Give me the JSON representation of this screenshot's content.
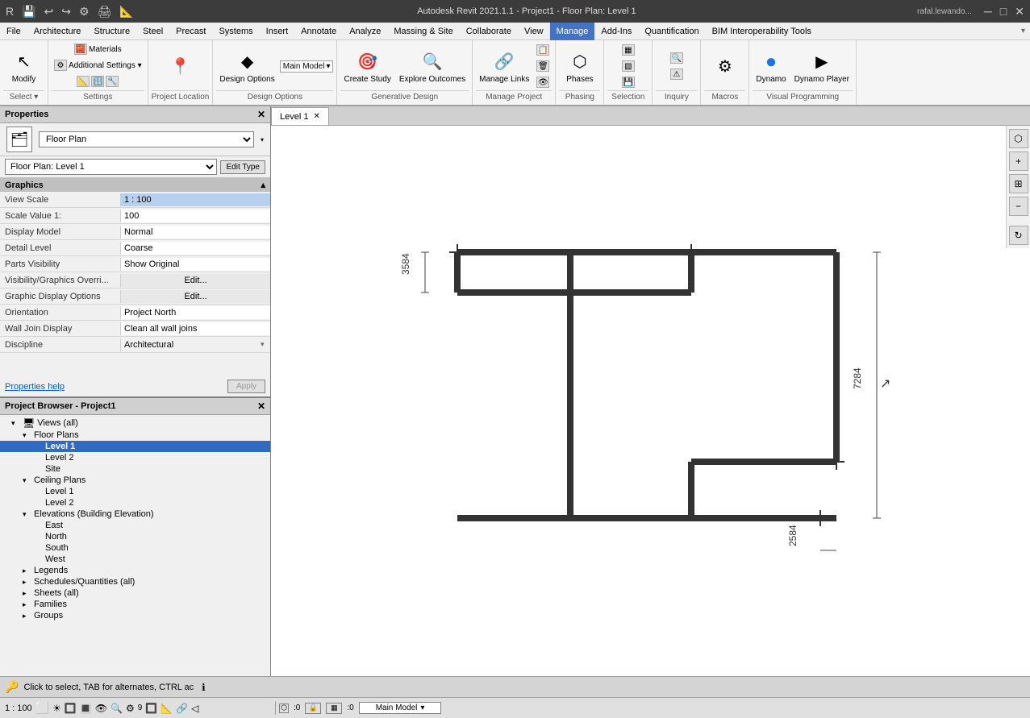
{
  "titlebar": {
    "title": "Autodesk Revit 2021.1.1 - Project1 - Floor Plan: Level 1",
    "user": "rafal.lewando...",
    "min": "─",
    "max": "□",
    "close": "✕"
  },
  "quickaccess": [
    "↩",
    "↪",
    "💾",
    "⚙",
    "▶"
  ],
  "menu": {
    "items": [
      "File",
      "Architecture",
      "Structure",
      "Steel",
      "Precast",
      "Systems",
      "Insert",
      "Annotate",
      "Analyze",
      "Massing & Site",
      "Collaborate",
      "View",
      "Manage",
      "Add-Ins",
      "Quantification",
      "BIM Interoperability Tools"
    ]
  },
  "ribbon": {
    "active_tab": "Manage",
    "groups": [
      {
        "label": "Select",
        "buttons": [
          {
            "icon": "↖",
            "label": "Modify",
            "large": true
          }
        ]
      },
      {
        "label": "Settings",
        "buttons": [
          {
            "icon": "🧱",
            "label": "Materials"
          },
          {
            "icon": "⚙",
            "label": "Additional\nSettings"
          },
          {
            "icon": "📐",
            "label": ""
          },
          {
            "icon": "🔢",
            "label": ""
          },
          {
            "icon": "🔧",
            "label": ""
          }
        ]
      },
      {
        "label": "Project Location",
        "buttons": [
          {
            "icon": "📍",
            "label": ""
          }
        ]
      },
      {
        "label": "Design Options",
        "buttons": [
          {
            "icon": "◆",
            "label": "Design Options"
          },
          {
            "icon": "▾",
            "label": "Main Model"
          }
        ]
      },
      {
        "label": "Generative Design",
        "buttons": [
          {
            "icon": "🎯",
            "label": "Create Study"
          },
          {
            "icon": "🔍",
            "label": "Explore Outcomes"
          }
        ]
      },
      {
        "label": "Manage Project",
        "buttons": [
          {
            "icon": "🔗",
            "label": "Manage Links"
          },
          {
            "icon": "📋",
            "label": ""
          },
          {
            "icon": "📊",
            "label": ""
          }
        ]
      },
      {
        "label": "Phasing",
        "buttons": [
          {
            "icon": "⬡",
            "label": "Phases"
          }
        ]
      },
      {
        "label": "Selection",
        "buttons": [
          {
            "icon": "▦",
            "label": ""
          },
          {
            "icon": "▧",
            "label": ""
          }
        ]
      },
      {
        "label": "Inquiry",
        "buttons": [
          {
            "icon": "📏",
            "label": ""
          },
          {
            "icon": "📐",
            "label": ""
          }
        ]
      },
      {
        "label": "Macros",
        "buttons": [
          {
            "icon": "⚙",
            "label": ""
          }
        ]
      },
      {
        "label": "Visual Programming",
        "buttons": [
          {
            "icon": "🔵",
            "label": "Dynamo"
          },
          {
            "icon": "▶",
            "label": "Dynamo Player"
          }
        ]
      }
    ]
  },
  "properties": {
    "title": "Properties",
    "type": "Floor Plan",
    "instance_label": "Floor Plan: Level 1",
    "edit_type_btn": "Edit Type",
    "section_label": "Graphics",
    "rows": [
      {
        "label": "View Scale",
        "value": "1 : 100",
        "blue": true
      },
      {
        "label": "Scale Value  1:",
        "value": "100",
        "blue": false
      },
      {
        "label": "Display Model",
        "value": "Normal",
        "blue": false
      },
      {
        "label": "Detail Level",
        "value": "Coarse",
        "blue": false
      },
      {
        "label": "Parts Visibility",
        "value": "Show Original",
        "blue": false
      },
      {
        "label": "Visibility/Graphics Overri...",
        "value": "Edit...",
        "blue": false,
        "editbtn": true
      },
      {
        "label": "Graphic Display Options",
        "value": "Edit...",
        "blue": false,
        "editbtn": true
      },
      {
        "label": "Orientation",
        "value": "Project North",
        "blue": false
      },
      {
        "label": "Wall Join Display",
        "value": "Clean all wall joins",
        "blue": false
      },
      {
        "label": "Discipline",
        "value": "Architectural",
        "blue": false
      }
    ],
    "props_help": "Properties help",
    "apply_btn": "Apply"
  },
  "browser": {
    "title": "Project Browser - Project1",
    "tree": [
      {
        "level": 1,
        "label": "Views (all)",
        "icon": "▾",
        "expanded": true
      },
      {
        "level": 2,
        "label": "Floor Plans",
        "icon": "▾",
        "expanded": true,
        "folderIcon": "📁"
      },
      {
        "level": 3,
        "label": "Level 1",
        "bold": true,
        "selected": true
      },
      {
        "level": 3,
        "label": "Level 2"
      },
      {
        "level": 3,
        "label": "Site"
      },
      {
        "level": 2,
        "label": "Ceiling Plans",
        "icon": "▾",
        "expanded": true,
        "folderIcon": "📁"
      },
      {
        "level": 3,
        "label": "Level 1"
      },
      {
        "level": 3,
        "label": "Level 2"
      },
      {
        "level": 2,
        "label": "Elevations (Building Elevation)",
        "icon": "▾",
        "expanded": true,
        "folderIcon": "📁"
      },
      {
        "level": 3,
        "label": "East"
      },
      {
        "level": 3,
        "label": "North"
      },
      {
        "level": 3,
        "label": "South"
      },
      {
        "level": 3,
        "label": "West"
      },
      {
        "level": 2,
        "label": "Legends",
        "folderIcon": "📋"
      },
      {
        "level": 2,
        "label": "Schedules/Quantities (all)",
        "folderIcon": "📊"
      },
      {
        "level": 2,
        "label": "Sheets (all)",
        "folderIcon": "📄"
      },
      {
        "level": 2,
        "label": "Families",
        "folderIcon": "🏠"
      },
      {
        "level": 2,
        "label": "Groups",
        "icon": "▾",
        "folderIcon": "📦"
      }
    ]
  },
  "tabs": {
    "open": [
      "Level 1"
    ]
  },
  "view_tab_label": "Level 1",
  "status_bar": {
    "message": "Click to select, TAB for alternates, CTRL ac",
    "scale": "1 : 100",
    "model": "Main Model"
  },
  "floor_plan": {
    "dim_3584": "3584",
    "dim_7284": "7284",
    "dim_2584": "2584"
  }
}
